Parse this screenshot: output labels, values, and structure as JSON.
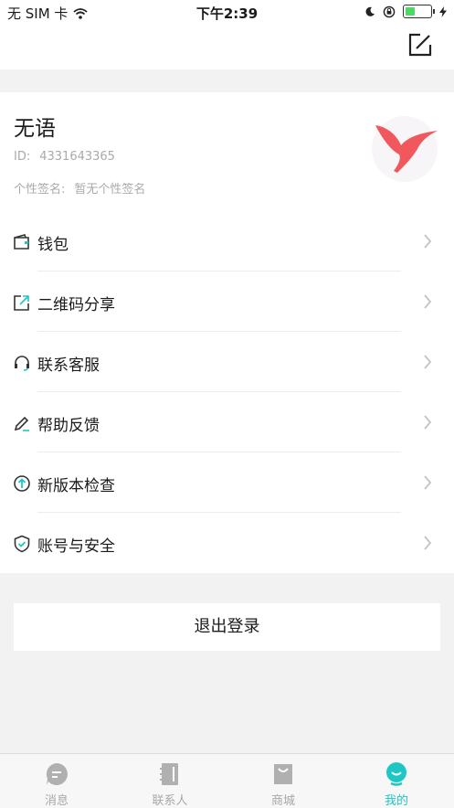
{
  "status_bar": {
    "carrier": "无 SIM 卡",
    "time": "下午2:39"
  },
  "profile": {
    "nickname": "无语",
    "id_label": "ID:",
    "id_value": "4331643365",
    "signature_label": "个性签名:",
    "signature_value": "暂无个性签名"
  },
  "menu": {
    "items": [
      {
        "label": "钱包",
        "icon": "wallet-icon"
      },
      {
        "label": "二维码分享",
        "icon": "share-icon"
      },
      {
        "label": "联系客服",
        "icon": "headset-icon"
      },
      {
        "label": "帮助反馈",
        "icon": "pencil-icon"
      },
      {
        "label": "新版本检查",
        "icon": "upgrade-icon"
      },
      {
        "label": "账号与安全",
        "icon": "shield-icon"
      }
    ]
  },
  "logout": {
    "label": "退出登录"
  },
  "tabbar": {
    "tabs": [
      {
        "label": "消息",
        "icon": "message-icon"
      },
      {
        "label": "联系人",
        "icon": "contacts-icon"
      },
      {
        "label": "商城",
        "icon": "shop-icon"
      },
      {
        "label": "我的",
        "icon": "profile-icon",
        "active": true
      }
    ]
  },
  "colors": {
    "accent": "#1fc7c4",
    "avatar_bird": "#f0585e",
    "divider": "#ececec",
    "background": "#f2f2f2"
  }
}
